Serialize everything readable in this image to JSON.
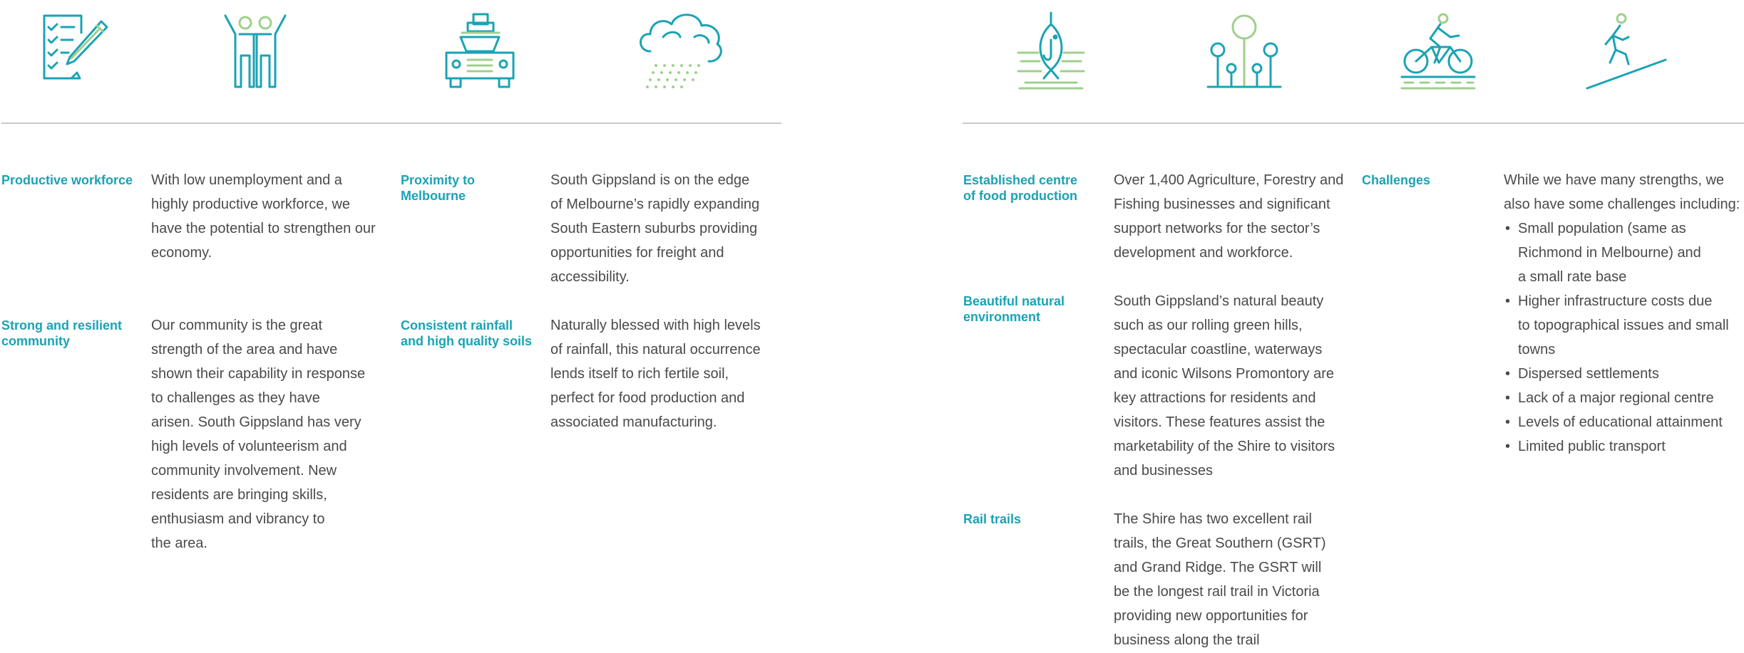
{
  "colors": {
    "accent_teal": "#1aa3b5",
    "accent_green": "#9ed08c",
    "body_text": "#4a4a4a",
    "rule": "#c9c9c9"
  },
  "icons": [
    "checklist-pencil-icon",
    "people-raising-hands-icon",
    "car-with-luggage-icon",
    "rain-cloud-icon",
    "fish-hook-icon",
    "trees-icon",
    "cyclist-icon",
    "person-walking-uphill-icon"
  ],
  "left": {
    "col1": [
      {
        "label": "Productive workforce",
        "text": "With low unemployment and a\nhighly productive workforce, we\nhave the potential to strengthen our\neconomy."
      },
      {
        "label": "Strong and resilient\ncommunity",
        "text": "Our community is the great\nstrength of the area and have\nshown their capability in response\nto challenges as they have\narisen. South Gippsland has very\nhigh levels of volunteerism and\ncommunity involvement. New\nresidents are bringing skills,\nenthusiasm and vibrancy to\nthe area."
      }
    ],
    "col2": [
      {
        "label": "Proximity to\nMelbourne",
        "text": "South Gippsland is on the edge\nof Melbourne’s rapidly expanding\nSouth Eastern suburbs providing\nopportunities for freight and\naccessibility."
      },
      {
        "label": "Consistent rainfall\nand high quality soils",
        "text": "Naturally blessed with high levels\nof rainfall, this natural occurrence\nlends itself to rich fertile soil,\nperfect for food production and\nassociated manufacturing."
      }
    ]
  },
  "right": {
    "col1": [
      {
        "label": "Established centre\nof food production",
        "text": "Over 1,400 Agriculture, Forestry and\nFishing businesses and significant\nsupport networks for the sector’s\ndevelopment and workforce."
      },
      {
        "label": "Beautiful natural\nenvironment",
        "text": "South Gippsland’s natural beauty\nsuch as our rolling green hills,\nspectacular coastline, waterways\nand iconic Wilsons Promontory are\nkey attractions for residents and\nvisitors. These features assist the\nmarketability of the Shire to visitors\nand businesses"
      },
      {
        "label": "Rail trails",
        "text": "The Shire has two excellent rail\ntrails, the Great Southern (GSRT)\nand Grand Ridge. The GSRT will\nbe the longest rail trail in Victoria\nproviding new opportunities for\nbusiness along the trail"
      }
    ],
    "challenges": {
      "label": "Challenges",
      "intro": "While we have many strengths, we\nalso have some challenges including:",
      "items": [
        "Small population (same as\nRichmond in Melbourne) and\na small rate base",
        "Higher infrastructure costs due\nto topographical issues and small\ntowns",
        "Dispersed settlements",
        "Lack of a major regional centre",
        "Levels of educational attainment",
        "Limited public transport"
      ]
    }
  }
}
